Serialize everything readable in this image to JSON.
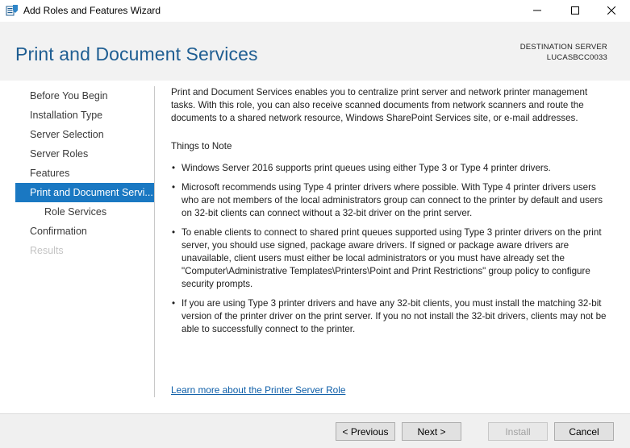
{
  "window": {
    "title": "Add Roles and Features Wizard",
    "icon": "server-manager-icon"
  },
  "header": {
    "page_title": "Print and Document Services",
    "destination_label": "DESTINATION SERVER",
    "destination_server": "LUCASBCC0033"
  },
  "nav": {
    "items": [
      {
        "label": "Before You Begin",
        "state": "normal"
      },
      {
        "label": "Installation Type",
        "state": "normal"
      },
      {
        "label": "Server Selection",
        "state": "normal"
      },
      {
        "label": "Server Roles",
        "state": "normal"
      },
      {
        "label": "Features",
        "state": "normal"
      },
      {
        "label": "Print and Document Servi...",
        "state": "active"
      },
      {
        "label": "Role Services",
        "state": "sub"
      },
      {
        "label": "Confirmation",
        "state": "normal"
      },
      {
        "label": "Results",
        "state": "disabled"
      }
    ]
  },
  "main": {
    "intro": "Print and Document Services enables you to centralize print server and network printer management tasks. With this role, you can also receive scanned documents from network scanners and route the documents to a shared network resource, Windows SharePoint Services site, or e-mail addresses.",
    "things_heading": "Things to Note",
    "bullet_char": "•",
    "bullets": [
      "Windows Server 2016 supports print queues using either Type 3 or Type 4 printer drivers.",
      "Microsoft recommends using Type 4 printer drivers where possible. With Type 4 printer drivers users who are not members of the local administrators group can connect to the printer by default and users on 32-bit clients can connect without a 32-bit driver on the print server.",
      "To enable clients to connect to shared print queues supported using Type 3 printer drivers on the print server, you should use signed, package aware drivers. If signed or package aware drivers are unavailable, client users must either be local administrators or you must have already set the \"Computer\\Administrative Templates\\Printers\\Point and Print Restrictions\" group policy to configure security prompts.",
      "If you are using Type 3 printer drivers and have any 32-bit clients, you must install the matching 32-bit version of the printer driver on the print server. If you no not install the 32-bit drivers, clients may not be able to successfully connect to the printer."
    ],
    "learn_more": "Learn more about the Printer Server Role"
  },
  "footer": {
    "previous": "< Previous",
    "next": "Next >",
    "install": "Install",
    "cancel": "Cancel"
  },
  "colors": {
    "accent": "#1a78c2",
    "title": "#1f5e92",
    "link": "#0d5ea8"
  }
}
